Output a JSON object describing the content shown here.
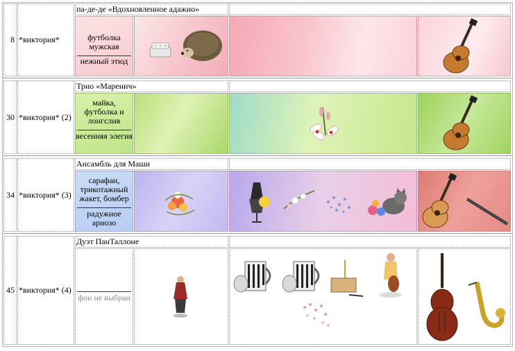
{
  "rows": [
    {
      "number": "8",
      "performer": "*виктория*",
      "title": "па-де-де «Вдохновленное адажио»",
      "costume": "футболка мужская",
      "music": "нежный этюд",
      "background": "pink-soft",
      "props": [
        "crown-icon",
        "hedgehog-icon"
      ],
      "scene_items": [],
      "instruments": [
        "guitar-icon"
      ]
    },
    {
      "number": "30",
      "performer": "*виктория* (2)",
      "title": "Трио «Маренич»",
      "costume": "майка, футболка и лонгслив",
      "music": "весенняя элегия",
      "background": "green-soft",
      "props": [],
      "scene_items": [
        "lily-flower-icon"
      ],
      "instruments": [
        "guitar-icon"
      ]
    },
    {
      "number": "34",
      "performer": "*виктория* (3)",
      "title": "Ансамбль для Маши",
      "costume": "сарафан, трикотажный жакет, бомбер",
      "music": "радужное ариозо",
      "background": "lavender-soft",
      "props": [
        "flower-bouquet-icon"
      ],
      "scene_items": [
        "dress-mannequin-icon",
        "flower-branch-icon",
        "butterflies-icon",
        "kitten-with-yarn-icon"
      ],
      "instruments": [
        "guitar-icon",
        "flute-icon"
      ]
    },
    {
      "number": "45",
      "performer": "*виктория* (4)",
      "title": "Дуэт ПанТаллоне",
      "costume": "",
      "music": "фон не выбран",
      "background": "none",
      "props": [
        "pantalone-figurine-icon"
      ],
      "scene_items": [
        "piano-mug-icon",
        "piano-mug-icon",
        "tuning-fork-icon",
        "cellist-figurine-icon",
        "petals-icon"
      ],
      "instruments": [
        "double-bass-icon",
        "saxophone-icon"
      ]
    }
  ],
  "colors": {
    "pink": "#f6b8c2",
    "green": "#bfe48a",
    "lavender": "#c8b7ee",
    "rose": "#e6857a",
    "border": "#8a8a8a"
  }
}
